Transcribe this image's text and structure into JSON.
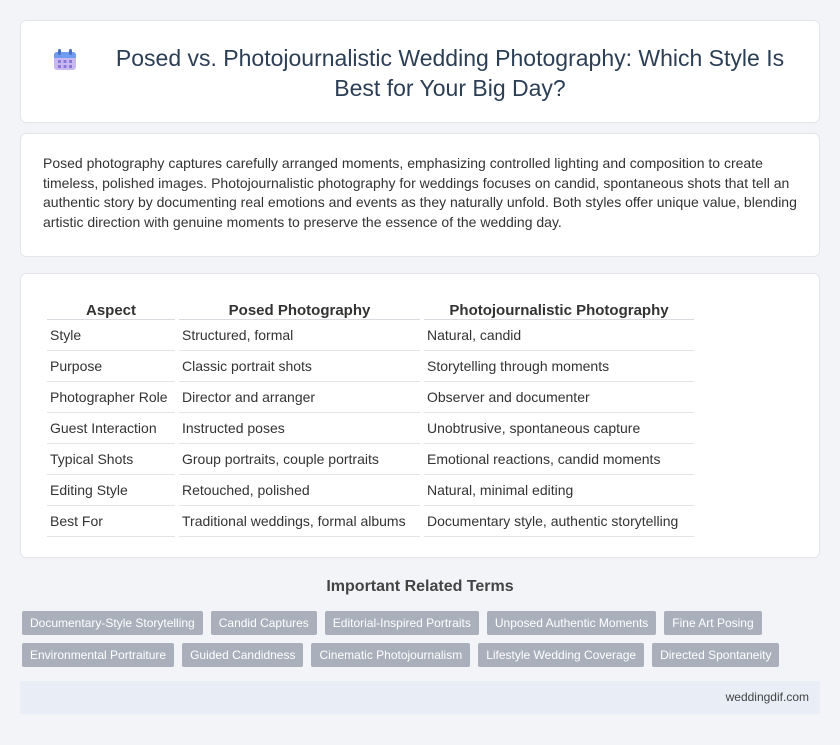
{
  "header": {
    "title": "Posed vs. Photojournalistic Wedding Photography: Which Style Is Best for Your Big Day?",
    "icon": "calendar-icon"
  },
  "intro": {
    "text": "Posed photography captures carefully arranged moments, emphasizing controlled lighting and composition to create timeless, polished images. Photojournalistic photography for weddings focuses on candid, spontaneous shots that tell an authentic story by documenting real emotions and events as they naturally unfold. Both styles offer unique value, blending artistic direction with genuine moments to preserve the essence of the wedding day."
  },
  "table": {
    "headers": [
      "Aspect",
      "Posed Photography",
      "Photojournalistic Photography"
    ],
    "rows": [
      [
        "Style",
        "Structured, formal",
        "Natural, candid"
      ],
      [
        "Purpose",
        "Classic portrait shots",
        "Storytelling through moments"
      ],
      [
        "Photographer Role",
        "Director and arranger",
        "Observer and documenter"
      ],
      [
        "Guest Interaction",
        "Instructed poses",
        "Unobtrusive, spontaneous capture"
      ],
      [
        "Typical Shots",
        "Group portraits, couple portraits",
        "Emotional reactions, candid moments"
      ],
      [
        "Editing Style",
        "Retouched, polished",
        "Natural, minimal editing"
      ],
      [
        "Best For",
        "Traditional weddings, formal albums",
        "Documentary style, authentic storytelling"
      ]
    ]
  },
  "related": {
    "heading": "Important Related Terms",
    "tags_row1": [
      "Documentary-Style Storytelling",
      "Candid Captures",
      "Editorial-Inspired Portraits",
      "Unposed Authentic Moments",
      "Fine Art Posing"
    ],
    "tags_row2": [
      "Environmental Portraiture",
      "Guided Candidness",
      "Cinematic Photojournalism",
      "Lifestyle Wedding Coverage",
      "Directed Spontaneity"
    ]
  },
  "footer": {
    "site": "weddingdif.com"
  },
  "colors": {
    "title": "#2c3e55",
    "tag_bg": "#a9b0bb",
    "footer_bg": "#e8edf6"
  }
}
